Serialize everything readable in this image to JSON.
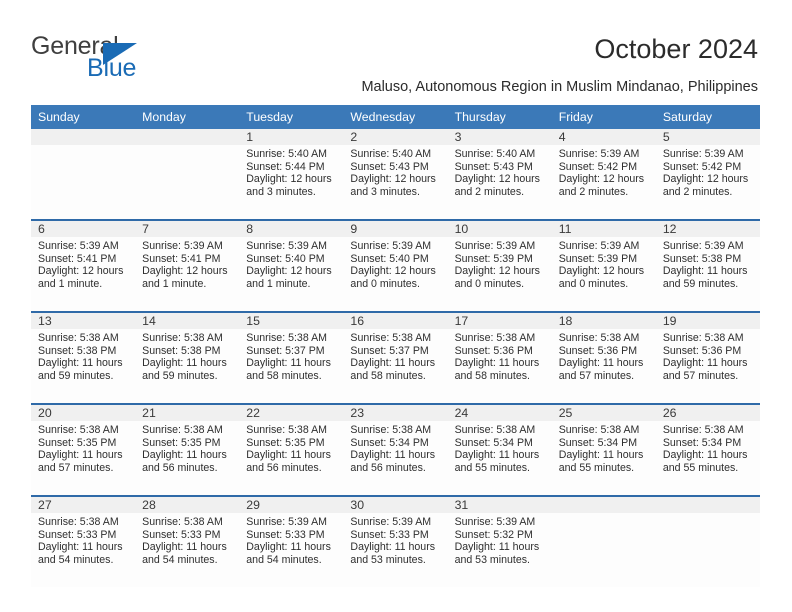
{
  "brand": {
    "name_part1": "General",
    "name_part2": "Blue",
    "accent_color": "#1a6bb5",
    "logo_icon": "triangle-icon"
  },
  "header": {
    "title": "October 2024",
    "subtitle": "Maluso, Autonomous Region in Muslim Mindanao, Philippines"
  },
  "theme": {
    "header_bg": "#3b79b8",
    "header_text": "#ffffff",
    "row_divider": "#2f6aa8",
    "daynum_bg": "#f0f0f0",
    "cell_bg": "#fdfdfd"
  },
  "calendar": {
    "weekday_headers": [
      "Sunday",
      "Monday",
      "Tuesday",
      "Wednesday",
      "Thursday",
      "Friday",
      "Saturday"
    ],
    "weeks": [
      [
        {
          "day": "",
          "sunrise": "",
          "sunset": "",
          "daylight": "",
          "daylight2": "",
          "empty": true
        },
        {
          "day": "",
          "sunrise": "",
          "sunset": "",
          "daylight": "",
          "daylight2": "",
          "empty": true
        },
        {
          "day": "1",
          "sunrise": "Sunrise: 5:40 AM",
          "sunset": "Sunset: 5:44 PM",
          "daylight": "Daylight: 12 hours",
          "daylight2": "and 3 minutes.",
          "empty": false
        },
        {
          "day": "2",
          "sunrise": "Sunrise: 5:40 AM",
          "sunset": "Sunset: 5:43 PM",
          "daylight": "Daylight: 12 hours",
          "daylight2": "and 3 minutes.",
          "empty": false
        },
        {
          "day": "3",
          "sunrise": "Sunrise: 5:40 AM",
          "sunset": "Sunset: 5:43 PM",
          "daylight": "Daylight: 12 hours",
          "daylight2": "and 2 minutes.",
          "empty": false
        },
        {
          "day": "4",
          "sunrise": "Sunrise: 5:39 AM",
          "sunset": "Sunset: 5:42 PM",
          "daylight": "Daylight: 12 hours",
          "daylight2": "and 2 minutes.",
          "empty": false
        },
        {
          "day": "5",
          "sunrise": "Sunrise: 5:39 AM",
          "sunset": "Sunset: 5:42 PM",
          "daylight": "Daylight: 12 hours",
          "daylight2": "and 2 minutes.",
          "empty": false
        }
      ],
      [
        {
          "day": "6",
          "sunrise": "Sunrise: 5:39 AM",
          "sunset": "Sunset: 5:41 PM",
          "daylight": "Daylight: 12 hours",
          "daylight2": "and 1 minute.",
          "empty": false
        },
        {
          "day": "7",
          "sunrise": "Sunrise: 5:39 AM",
          "sunset": "Sunset: 5:41 PM",
          "daylight": "Daylight: 12 hours",
          "daylight2": "and 1 minute.",
          "empty": false
        },
        {
          "day": "8",
          "sunrise": "Sunrise: 5:39 AM",
          "sunset": "Sunset: 5:40 PM",
          "daylight": "Daylight: 12 hours",
          "daylight2": "and 1 minute.",
          "empty": false
        },
        {
          "day": "9",
          "sunrise": "Sunrise: 5:39 AM",
          "sunset": "Sunset: 5:40 PM",
          "daylight": "Daylight: 12 hours",
          "daylight2": "and 0 minutes.",
          "empty": false
        },
        {
          "day": "10",
          "sunrise": "Sunrise: 5:39 AM",
          "sunset": "Sunset: 5:39 PM",
          "daylight": "Daylight: 12 hours",
          "daylight2": "and 0 minutes.",
          "empty": false
        },
        {
          "day": "11",
          "sunrise": "Sunrise: 5:39 AM",
          "sunset": "Sunset: 5:39 PM",
          "daylight": "Daylight: 12 hours",
          "daylight2": "and 0 minutes.",
          "empty": false
        },
        {
          "day": "12",
          "sunrise": "Sunrise: 5:39 AM",
          "sunset": "Sunset: 5:38 PM",
          "daylight": "Daylight: 11 hours",
          "daylight2": "and 59 minutes.",
          "empty": false
        }
      ],
      [
        {
          "day": "13",
          "sunrise": "Sunrise: 5:38 AM",
          "sunset": "Sunset: 5:38 PM",
          "daylight": "Daylight: 11 hours",
          "daylight2": "and 59 minutes.",
          "empty": false
        },
        {
          "day": "14",
          "sunrise": "Sunrise: 5:38 AM",
          "sunset": "Sunset: 5:38 PM",
          "daylight": "Daylight: 11 hours",
          "daylight2": "and 59 minutes.",
          "empty": false
        },
        {
          "day": "15",
          "sunrise": "Sunrise: 5:38 AM",
          "sunset": "Sunset: 5:37 PM",
          "daylight": "Daylight: 11 hours",
          "daylight2": "and 58 minutes.",
          "empty": false
        },
        {
          "day": "16",
          "sunrise": "Sunrise: 5:38 AM",
          "sunset": "Sunset: 5:37 PM",
          "daylight": "Daylight: 11 hours",
          "daylight2": "and 58 minutes.",
          "empty": false
        },
        {
          "day": "17",
          "sunrise": "Sunrise: 5:38 AM",
          "sunset": "Sunset: 5:36 PM",
          "daylight": "Daylight: 11 hours",
          "daylight2": "and 58 minutes.",
          "empty": false
        },
        {
          "day": "18",
          "sunrise": "Sunrise: 5:38 AM",
          "sunset": "Sunset: 5:36 PM",
          "daylight": "Daylight: 11 hours",
          "daylight2": "and 57 minutes.",
          "empty": false
        },
        {
          "day": "19",
          "sunrise": "Sunrise: 5:38 AM",
          "sunset": "Sunset: 5:36 PM",
          "daylight": "Daylight: 11 hours",
          "daylight2": "and 57 minutes.",
          "empty": false
        }
      ],
      [
        {
          "day": "20",
          "sunrise": "Sunrise: 5:38 AM",
          "sunset": "Sunset: 5:35 PM",
          "daylight": "Daylight: 11 hours",
          "daylight2": "and 57 minutes.",
          "empty": false
        },
        {
          "day": "21",
          "sunrise": "Sunrise: 5:38 AM",
          "sunset": "Sunset: 5:35 PM",
          "daylight": "Daylight: 11 hours",
          "daylight2": "and 56 minutes.",
          "empty": false
        },
        {
          "day": "22",
          "sunrise": "Sunrise: 5:38 AM",
          "sunset": "Sunset: 5:35 PM",
          "daylight": "Daylight: 11 hours",
          "daylight2": "and 56 minutes.",
          "empty": false
        },
        {
          "day": "23",
          "sunrise": "Sunrise: 5:38 AM",
          "sunset": "Sunset: 5:34 PM",
          "daylight": "Daylight: 11 hours",
          "daylight2": "and 56 minutes.",
          "empty": false
        },
        {
          "day": "24",
          "sunrise": "Sunrise: 5:38 AM",
          "sunset": "Sunset: 5:34 PM",
          "daylight": "Daylight: 11 hours",
          "daylight2": "and 55 minutes.",
          "empty": false
        },
        {
          "day": "25",
          "sunrise": "Sunrise: 5:38 AM",
          "sunset": "Sunset: 5:34 PM",
          "daylight": "Daylight: 11 hours",
          "daylight2": "and 55 minutes.",
          "empty": false
        },
        {
          "day": "26",
          "sunrise": "Sunrise: 5:38 AM",
          "sunset": "Sunset: 5:34 PM",
          "daylight": "Daylight: 11 hours",
          "daylight2": "and 55 minutes.",
          "empty": false
        }
      ],
      [
        {
          "day": "27",
          "sunrise": "Sunrise: 5:38 AM",
          "sunset": "Sunset: 5:33 PM",
          "daylight": "Daylight: 11 hours",
          "daylight2": "and 54 minutes.",
          "empty": false
        },
        {
          "day": "28",
          "sunrise": "Sunrise: 5:38 AM",
          "sunset": "Sunset: 5:33 PM",
          "daylight": "Daylight: 11 hours",
          "daylight2": "and 54 minutes.",
          "empty": false
        },
        {
          "day": "29",
          "sunrise": "Sunrise: 5:39 AM",
          "sunset": "Sunset: 5:33 PM",
          "daylight": "Daylight: 11 hours",
          "daylight2": "and 54 minutes.",
          "empty": false
        },
        {
          "day": "30",
          "sunrise": "Sunrise: 5:39 AM",
          "sunset": "Sunset: 5:33 PM",
          "daylight": "Daylight: 11 hours",
          "daylight2": "and 53 minutes.",
          "empty": false
        },
        {
          "day": "31",
          "sunrise": "Sunrise: 5:39 AM",
          "sunset": "Sunset: 5:32 PM",
          "daylight": "Daylight: 11 hours",
          "daylight2": "and 53 minutes.",
          "empty": false
        },
        {
          "day": "",
          "sunrise": "",
          "sunset": "",
          "daylight": "",
          "daylight2": "",
          "empty": true
        },
        {
          "day": "",
          "sunrise": "",
          "sunset": "",
          "daylight": "",
          "daylight2": "",
          "empty": true
        }
      ]
    ]
  }
}
